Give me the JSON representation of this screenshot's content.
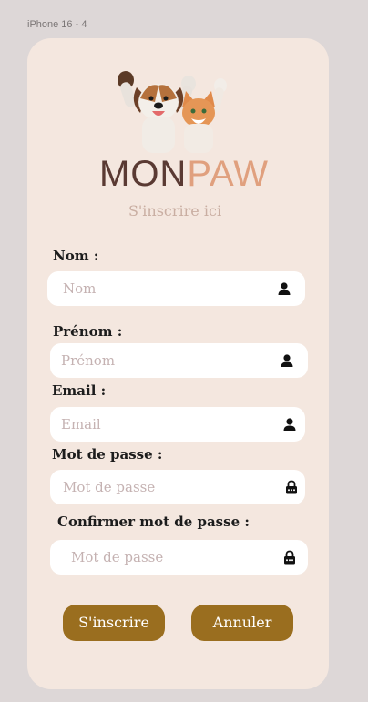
{
  "frame": {
    "label": "iPhone 16 - 4"
  },
  "brand": {
    "part1": "MON",
    "part2": "PAW"
  },
  "subtitle": "S'inscrire ici",
  "form": {
    "nom": {
      "label": "Nom :",
      "placeholder": "Nom",
      "icon": "user-icon"
    },
    "prenom": {
      "label": "Prénom :",
      "placeholder": "Prénom",
      "icon": "user-icon"
    },
    "email": {
      "label": "Email :",
      "placeholder": "Email",
      "icon": "user-icon"
    },
    "password": {
      "label": "Mot de passe :",
      "placeholder": "Mot de passe",
      "icon": "lock-icon"
    },
    "confirm": {
      "label": "Confirmer mot de passe :",
      "placeholder": "Mot de passe",
      "icon": "lock-icon"
    }
  },
  "buttons": {
    "submit": "S'inscrire",
    "cancel": "Annuler"
  },
  "colors": {
    "background": "#ddd7d7",
    "card": "#f4e7df",
    "brand_dark": "#5a3a33",
    "brand_light": "#e0a07e",
    "button": "#9a6e1f"
  }
}
